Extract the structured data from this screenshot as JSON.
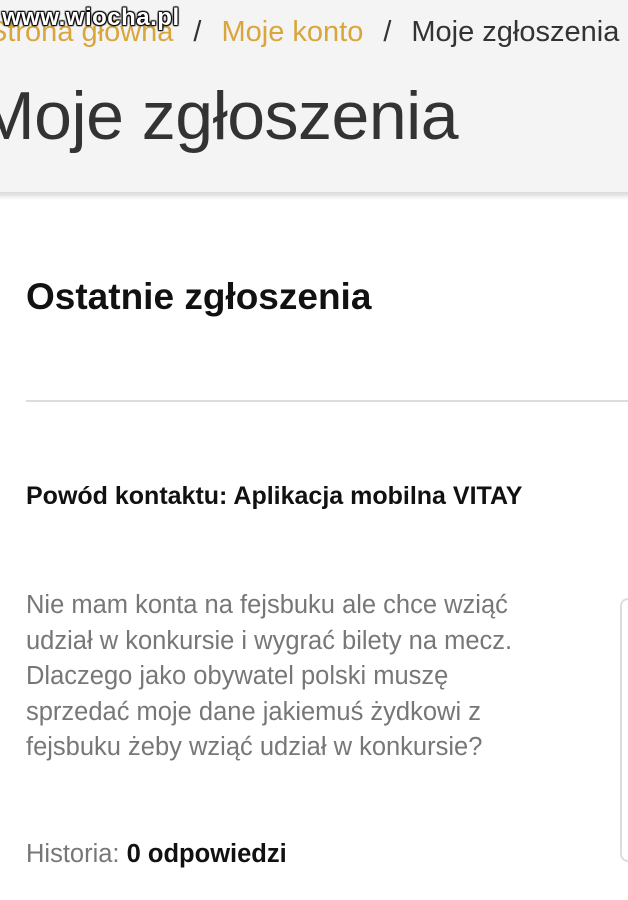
{
  "watermark": "www.wiocha.pl",
  "breadcrumb": {
    "home": "Strona główna",
    "separator": "/",
    "account": "Moje konto",
    "current": "Moje zgłoszenia"
  },
  "page_title": "Moje zgłoszenia",
  "section_title": "Ostatnie zgłoszenia",
  "ticket": {
    "reason_label": "Powód kontaktu: Aplikacja mobilna VITAY",
    "message_lines": [
      "Nie mam konta na fejsbuku ale chce wziąć",
      "udział w konkursie i wygrać bilety na mecz.",
      "Dlaczego jako obywatel polski muszę",
      "sprzedać moje dane jakiemuś żydkowi z",
      "fejsbuku żeby wziąć udział w konkursie?"
    ],
    "history_label": "Historia:",
    "history_count": "0 odpowiedzi"
  },
  "colors": {
    "breadcrumb_link": "#d9a63b",
    "header_background": "#f4f4f4",
    "text_dark": "#111111",
    "text_muted": "#777777"
  }
}
